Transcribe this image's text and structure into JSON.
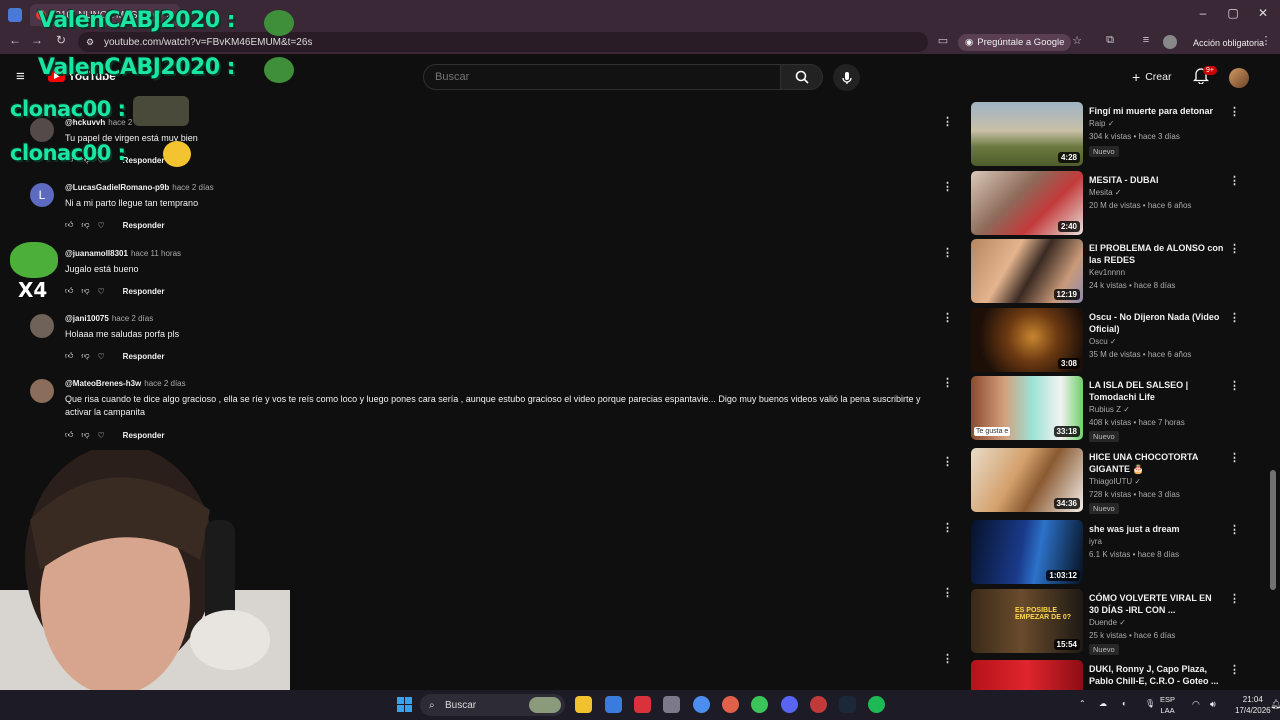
{
  "browser": {
    "tab_title": "(210) NUNCA MAS PAGARE PO...",
    "url": "youtube.com/watch?v=FBvKM46EMUM&t=26s",
    "ask_google": "Pregúntale a Google",
    "update_label": "Acción obligatoria"
  },
  "youtube": {
    "logo_text": "YouTube",
    "search_placeholder": "Buscar",
    "create_label": "Crear",
    "notif_count": "9+"
  },
  "comments": [
    {
      "user": "@hckuvvh",
      "time": "hace 2",
      "text": "Tu papel de virgen está muy bien",
      "reply": "Responder"
    },
    {
      "user": "@LucasGadielRomano-p9b",
      "time": "hace 2 días",
      "text": "Ni a mi parto llegue tan temprano",
      "reply": "Responder",
      "avatar_letter": "L"
    },
    {
      "user": "@juanamoll8301",
      "time": "hace 11 horas",
      "text": "Jugalo está bueno",
      "reply": "Responder"
    },
    {
      "user": "@jani10075",
      "time": "hace 2 días",
      "text": "Holaaa me saludas porfa pls",
      "reply": "Responder"
    },
    {
      "user": "@MateoBrenes-h3w",
      "time": "hace 2 días",
      "text": "Que risa cuando te dice algo gracioso , ella se ríe y vos te reís como loco y luego pones cara sería , aunque estubo gracioso el video porque parecias espantavie... Digo muy buenos videos valió la pena suscribirte y activar la campanita",
      "reply": "Responder"
    }
  ],
  "videos": [
    {
      "title": "Fingí mi muerte para detonar",
      "channel": "Raip",
      "verified": true,
      "stats": "304 k vistas • hace 3 días",
      "badge": "Nuevo",
      "duration": "4:28"
    },
    {
      "title": "MESITA - DUBAI",
      "channel": "Mesita",
      "verified": true,
      "stats": "20 M de vistas • hace 6 años",
      "badge": "",
      "duration": "2:40"
    },
    {
      "title": "El PROBLEMA de ALONSO con las REDES",
      "channel": "Kev1nnnn",
      "verified": false,
      "stats": "24 k vistas • hace 8 días",
      "badge": "",
      "duration": "12:19"
    },
    {
      "title": "Oscu - No Dijeron Nada (Video Oficial)",
      "channel": "Oscu",
      "verified": true,
      "stats": "35 M de vistas • hace 6 años",
      "badge": "",
      "duration": "3:08"
    },
    {
      "title": "LA ISLA DEL SALSEO | Tomodachi Life",
      "channel": "Rubius Z",
      "verified": true,
      "stats": "408 k vistas • hace 7 horas",
      "badge": "Nuevo",
      "duration": "33:18"
    },
    {
      "title": "HICE UNA CHOCOTORTA GIGANTE 🎂",
      "channel": "ThiagoIUTU",
      "verified": true,
      "stats": "728 k vistas • hace 3 días",
      "badge": "Nuevo",
      "duration": "34:36"
    },
    {
      "title": "she was just a dream",
      "channel": "iyra",
      "verified": false,
      "stats": "6.1 K vistas • hace 8 días",
      "badge": "",
      "duration": "1:03:12"
    },
    {
      "title": "CÓMO VOLVERTE VIRAL EN 30 DÍAS -IRL CON ...",
      "channel": "Duende",
      "verified": true,
      "stats": "25 k vistas • hace 6 días",
      "badge": "Nuevo",
      "duration": "15:54"
    },
    {
      "title": "DUKI, Ronny J, Capo Plaza, Pablo Chill-E, C.R.O - Goteo ...",
      "channel": "",
      "verified": false,
      "stats": "",
      "badge": "",
      "duration": ""
    }
  ],
  "thumb_text": {
    "v5": "Te gusta e",
    "v8": "ES POSIBLE EMPEZAR DE 0?"
  },
  "overlay": {
    "name1": "ValenCABJ2020 :",
    "name2": "clonac00 :",
    "x4": "X4"
  },
  "taskbar": {
    "search": "Buscar",
    "lang1": "ESP",
    "lang2": "LAA",
    "time": "21:04",
    "date": "17/4/2026"
  },
  "colors": {
    "accent_red": "#ff0000",
    "overlay_green": "#19e6a5",
    "bg": "#0f0f0f"
  }
}
